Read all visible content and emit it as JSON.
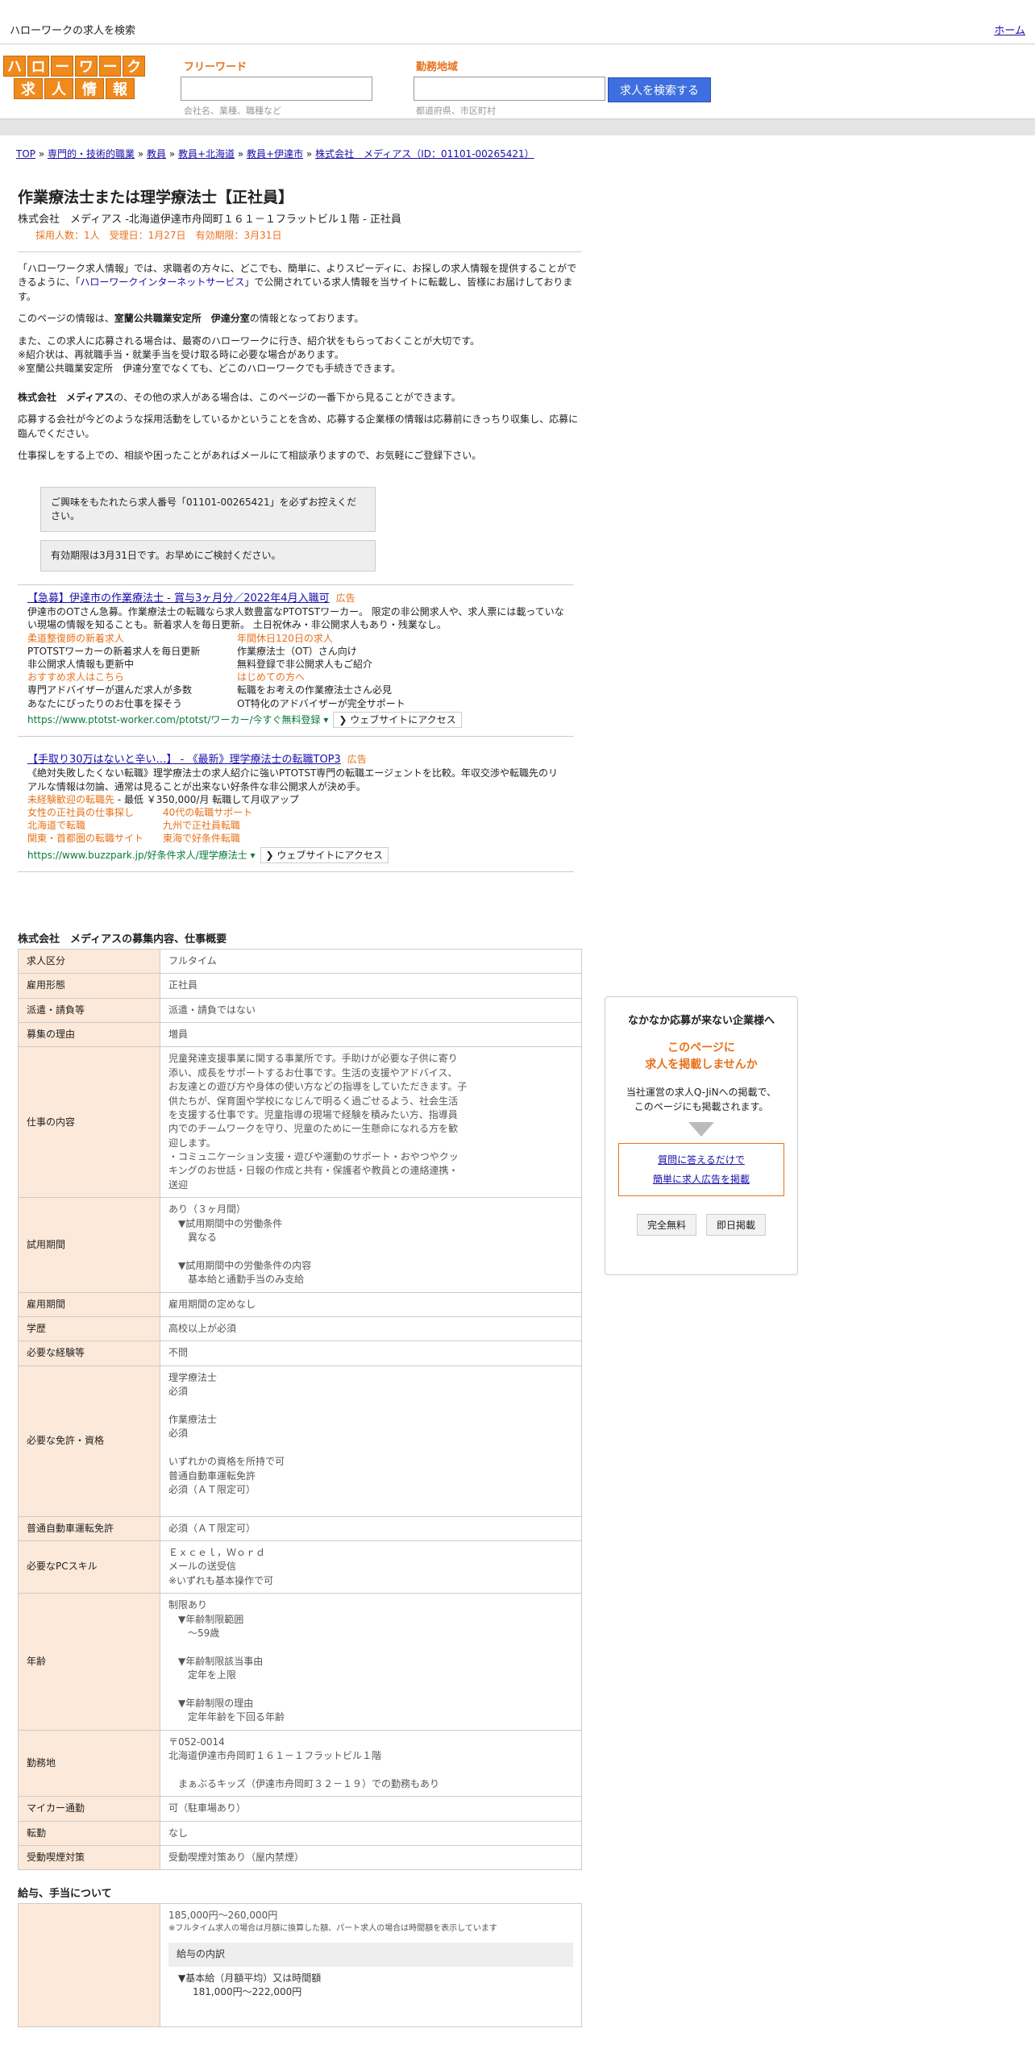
{
  "topbar": {
    "site_name": "ハローワークの求人を検索",
    "home_link": "ホーム"
  },
  "logo": {
    "row1": [
      "ハ",
      "ロ",
      "ー",
      "ワ",
      "ー",
      "ク"
    ],
    "row2": [
      "求",
      "人",
      "情",
      "報"
    ]
  },
  "search": {
    "keyword_label": "フリーワード",
    "keyword_hint": "会社名、業種、職種など",
    "location_label": "勤務地域",
    "location_hint": "都道府県、市区町村",
    "button": "求人を検索する"
  },
  "breadcrumb": [
    "TOP",
    "専門的・技術的職業",
    "教員",
    "教員+北海道",
    "教員+伊達市",
    "株式会社　メディアス（ID：01101-00265421）"
  ],
  "job": {
    "title": "作業療法士または理学療法士【正社員】",
    "company_line": "株式会社　メディアス -北海道伊達市舟岡町１６１－１フラットビル１階 - 正社員",
    "meta": "採用人数：1人　受理日：1月27日　有効期限：3月31日"
  },
  "intro": {
    "p1a": "「ハローワーク求人情報」では、求職者の方々に、どこでも、簡単に、よりスピーディに、お探しの求人情報を提供することができるように、「",
    "p1link": "ハローワークインターネットサービス",
    "p1b": "」で公開されている求人情報を当サイトに転載し、皆様にお届けしております。",
    "p2a": "このページの情報は、",
    "p2b": "室蘭公共職業安定所　伊達分室",
    "p2c": "の情報となっております。",
    "p3": [
      "また、この求人に応募される場合は、最寄のハローワークに行き、紹介状をもらっておくことが大切です。",
      "※紹介状は、再就職手当・就業手当を受け取る時に必要な場合があります。",
      "※室蘭公共職業安定所　伊達分室でなくても、どこのハローワークでも手続きできます。"
    ],
    "p4a": "株式会社　メディアス",
    "p4b": "の、その他の求人がある場合は、このページの一番下から見ることができます。",
    "p5": "応募する会社が今どのような採用活動をしているかということを含め、応募する企業様の情報は応募前にきっちり収集し、応募に臨んでください。",
    "p6": "仕事探しをする上での、相談や困ったことがあればメールにて相談承りますので、お気軽にご登録下さい。"
  },
  "notices": [
    "ご興味をもたれたら求人番号「01101-00265421」を必ずお控えください。",
    "有効期限は3月31日です。お早めにご検討ください。"
  ],
  "ads": [
    {
      "title": "【急募】伊達市の作業療法士 - 賞与3ヶ月分／2022年4月入職可",
      "tag": "広告",
      "desc": "伊達市のOTさん急募。作業療法士の転職なら求人数豊富なPTOTSTワーカー。 限定の非公開求人や、求人票には載っていない現場の情報を知ることも。新着求人を毎日更新。 土日祝休み・非公開求人もあり・残業なし。",
      "sitelinks": [
        {
          "title": "柔道整復師の新着求人",
          "lines": [
            "PTOTSTワーカーの新着求人を毎日更新",
            "非公開求人情報も更新中"
          ]
        },
        {
          "title": "年間休日120日の求人",
          "lines": [
            "作業療法士（OT）さん向け",
            "無料登録で非公開求人もご紹介"
          ]
        },
        {
          "title": "おすすめ求人はこちら",
          "lines": [
            "専門アドバイザーが選んだ求人が多数",
            "あなたにぴったりのお仕事を探そう"
          ]
        },
        {
          "title": "はじめての方へ",
          "lines": [
            "転職をお考えの作業療法士さん必見",
            "OT特化のアドバイザーが完全サポート"
          ]
        }
      ],
      "url": "https://www.ptotst-worker.com/ptotst/ワーカー/今すぐ無料登録",
      "visit": "ウェブサイトにアクセス"
    },
    {
      "title": "【手取り30万はないと辛い…】 - 《最新》理学療法士の転職TOP3",
      "tag": "広告",
      "desc": "《絶対失敗したくない転職》理学療法士の求人紹介に強いPTOTST専門の転職エージェントを比較。年収交渉や転職先のリアルな情報は勿論、通常は見ることが出来ない好条件な非公開求人が決め手。",
      "highlight": "未経験歓迎の転職先",
      "extra": " - 最低 ￥350,000/月 転職して月収アップ",
      "links": [
        "女性の正社員の仕事探し",
        "40代の転職サポート",
        "北海道で転職",
        "九州で正社員転職",
        "関東・首都圏の転職サイト",
        "東海で好条件転職"
      ],
      "url": "https://www.buzzpark.jp/好条件求人/理学療法士",
      "visit": "ウェブサイトにアクセス"
    }
  ],
  "details_title": "株式会社　メディアスの募集内容、仕事概要",
  "details": [
    {
      "k": "求人区分",
      "v": [
        "フルタイム"
      ]
    },
    {
      "k": "雇用形態",
      "v": [
        "正社員"
      ]
    },
    {
      "k": "派遣・請負等",
      "v": [
        "派遣・請負ではない"
      ]
    },
    {
      "k": "募集の理由",
      "v": [
        "増員"
      ]
    },
    {
      "k": "仕事の内容",
      "v": [
        "児童発達支援事業に関する事業所です。手助けが必要な子供に寄り",
        "添い、成長をサポートするお仕事です。生活の支援やアドバイス、",
        "お友達との遊び方や身体の使い方などの指導をしていただきます。子",
        "供たちが、保育園や学校になじんで明るく過ごせるよう、社会生活",
        "を支援する仕事です。児童指導の現場で経験を積みたい方、指導員",
        "内でのチームワークを守り、児童のために一生懸命になれる方を歓",
        "迎します。",
        "・コミュニケーション支援・遊びや運動のサポート・おやつやクッ",
        "キングのお世話・日報の作成と共有・保護者や教員との連絡連携・",
        "送迎"
      ]
    },
    {
      "k": "試用期間",
      "v": [
        "あり（３ヶ月間）",
        "　▼試用期間中の労働条件",
        "　　異なる",
        "",
        "　▼試用期間中の労働条件の内容",
        "　　基本給と通勤手当のみ支給"
      ]
    },
    {
      "k": "雇用期間",
      "v": [
        "雇用期間の定めなし"
      ]
    },
    {
      "k": "学歴",
      "v": [
        "高校以上が必須"
      ]
    },
    {
      "k": "必要な経験等",
      "v": [
        "不問"
      ]
    },
    {
      "k": "必要な免許・資格",
      "v": [
        "理学療法士",
        "必須",
        "",
        "作業療法士",
        "必須",
        "",
        "いずれかの資格を所持で可",
        "普通自動車運転免許",
        "必須（ＡＴ限定可）",
        ""
      ]
    },
    {
      "k": "普通自動車運転免許",
      "v": [
        "必須（ＡＴ限定可）"
      ]
    },
    {
      "k": "必要なPCスキル",
      "v": [
        "Ｅｘｃｅｌ，Ｗｏｒｄ",
        "メールの送受信",
        "※いずれも基本操作で可"
      ]
    },
    {
      "k": "年齢",
      "v": [
        "制限あり",
        "　▼年齢制限範囲",
        "　　〜59歳",
        "",
        "　▼年齢制限該当事由",
        "　　定年を上限",
        "",
        "　▼年齢制限の理由",
        "　　定年年齢を下回る年齢"
      ]
    },
    {
      "k": "勤務地",
      "v": [
        "〒052-0014",
        "北海道伊達市舟岡町１６１－１フラットビル１階",
        "",
        "　まぁぶるキッズ（伊達市舟岡町３２－１９）での勤務もあり"
      ]
    },
    {
      "k": "マイカー通勤",
      "v": [
        "可（駐車場あり）"
      ]
    },
    {
      "k": "転勤",
      "v": [
        "なし"
      ]
    },
    {
      "k": "受動喫煙対策",
      "v": [
        "受動喫煙対策あり（屋内禁煙）"
      ]
    }
  ],
  "salary_title": "給与、手当について",
  "salary": {
    "range": "185,000円〜260,000円",
    "note": "※フルタイム求人の場合は月額に換算した額、パート求人の場合は時間額を表示しています",
    "breakdown_label": "給与の内訳",
    "base_label": "▼基本給（月額平均）又は時間額",
    "base_value": "181,000円〜222,000円"
  },
  "sidebar": {
    "heading": "なかなか応募が来ない企業様へ",
    "cta": [
      "このページに",
      "求人を掲載しませんか"
    ],
    "desc": [
      "当社運営の求人Q-JiNへの掲載で、",
      "このページにも掲載されます。"
    ],
    "links": [
      "質問に答えるだけで",
      "簡単に求人広告を掲載"
    ],
    "badges": [
      "完全無料",
      "即日掲載"
    ]
  }
}
